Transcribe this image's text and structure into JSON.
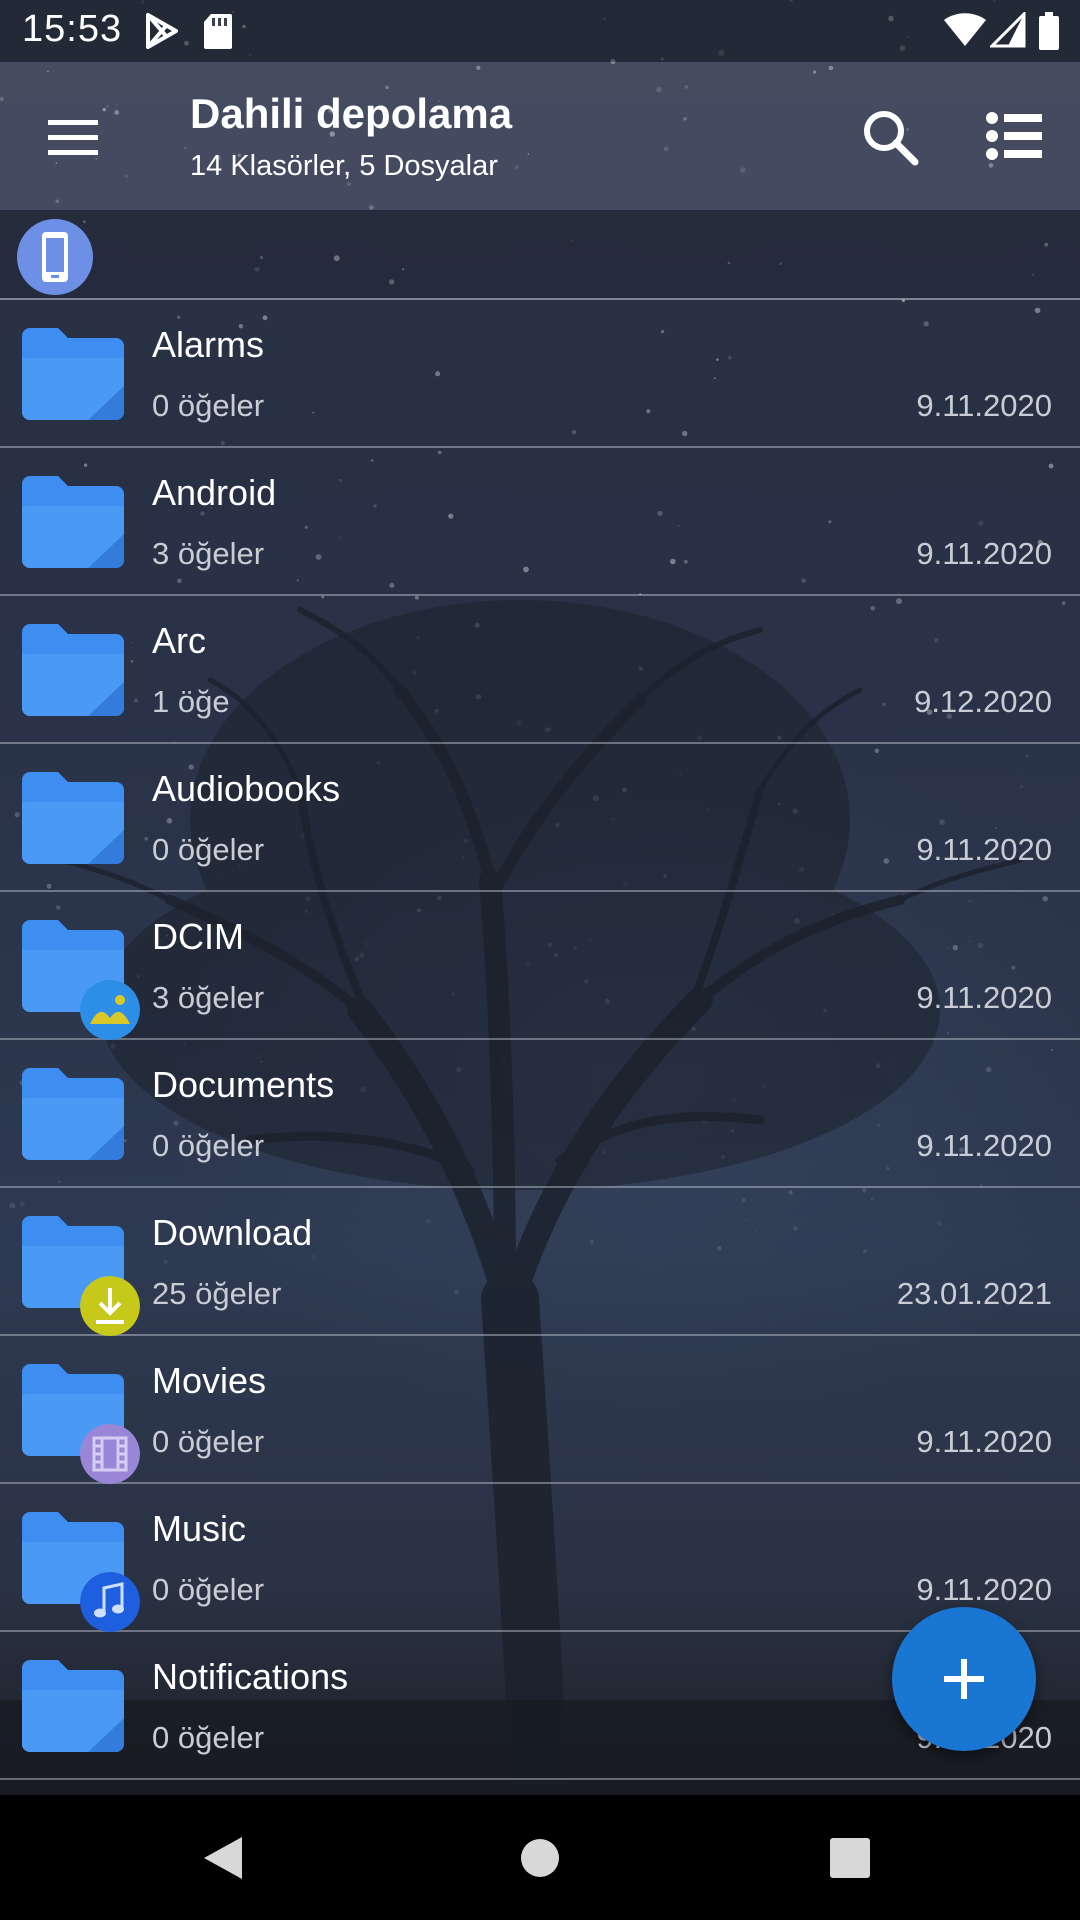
{
  "status_bar": {
    "time": "15:53",
    "icons": [
      "play-store-icon",
      "sd-card-icon",
      "wifi-icon",
      "signal-icon",
      "battery-icon"
    ]
  },
  "app_bar": {
    "title": "Dahili depolama",
    "subtitle": "14 Klasörler, 5 Dosyalar",
    "icons": [
      "menu-icon",
      "search-icon",
      "list-view-icon"
    ]
  },
  "breadcrumb": {
    "icon": "phone-icon"
  },
  "folders": [
    {
      "name": "Alarms",
      "count": "0 öğeler",
      "date": "9.11.2020",
      "badge": null
    },
    {
      "name": "Android",
      "count": "3 öğeler",
      "date": "9.11.2020",
      "badge": null
    },
    {
      "name": "Arc",
      "count": "1 öğe",
      "date": "9.12.2020",
      "badge": null
    },
    {
      "name": "Audiobooks",
      "count": "0 öğeler",
      "date": "9.11.2020",
      "badge": null
    },
    {
      "name": "DCIM",
      "count": "3 öğeler",
      "date": "9.11.2020",
      "badge": "image-badge-icon"
    },
    {
      "name": "Documents",
      "count": "0 öğeler",
      "date": "9.11.2020",
      "badge": null
    },
    {
      "name": "Download",
      "count": "25 öğeler",
      "date": "23.01.2021",
      "badge": "download-badge-icon"
    },
    {
      "name": "Movies",
      "count": "0 öğeler",
      "date": "9.11.2020",
      "badge": "movie-badge-icon"
    },
    {
      "name": "Music",
      "count": "0 öğeler",
      "date": "9.11.2020",
      "badge": "music-badge-icon"
    },
    {
      "name": "Notifications",
      "count": "0 öğeler",
      "date": "9.11.2020",
      "badge": null
    }
  ],
  "fab": {
    "icon": "plus-icon"
  },
  "nav_bar": {
    "icons": [
      "back-icon",
      "home-icon",
      "recents-icon"
    ]
  },
  "colors": {
    "folder": "#3d8ef0",
    "fab": "#1976d2",
    "chip": "#6e8fe6",
    "image_badge": "#2d8ee8",
    "download_badge": "#c6c81a",
    "movie_badge": "#9a86d6",
    "music_badge": "#1e5fe0"
  }
}
